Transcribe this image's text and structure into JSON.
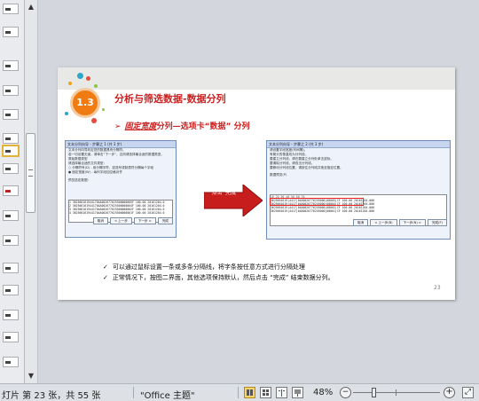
{
  "status": {
    "slide_info": "灯片 第 23 张，共 55 张",
    "theme": "\"Office 主题\"",
    "zoom": "48%",
    "zoom_out": "−",
    "zoom_in": "+"
  },
  "scrollbar": {
    "up": "▲",
    "down": "▼"
  },
  "slide": {
    "badge": "1.3",
    "title": "分析与筛选数据-数据分列",
    "subtitle_bullet": "➢",
    "subtitle_italic": "固定宽度",
    "subtitle_rest": "分列—选项卡“数据” 分列",
    "arrow_label": "点击“完成”",
    "bullets": [
      "可以通过鼠标设置一条或多条分隔线，将字条按任意方式进行分隔处理",
      "正常情况下，按图二界面，其他选项保持默认，然后点击 “完成” 结束数据分列。"
    ],
    "check": "✓",
    "page_number": "23"
  },
  "left_dialog": {
    "title": "文本分列向导 - 步骤之 1 (共 3 步)",
    "lines": [
      "文本分列向导判定您的数据具有分隔符。",
      "若一切设置无误，请单击“下一步”，否则请选择最合适的数据类型。",
      "原始数据类型",
      "请选择最合适的文件类型：",
      "○ 分隔符号(D) - 用分隔字符，如逗号或制表符分隔每个字段",
      "● 固定宽度(W) - 每列字段加空格对齐"
    ],
    "preview_label": "预览选定数据：",
    "rows": [
      "1 3625661619441704A002677625500000005F 100.00 20161204.0",
      "2 3625661619441704A002677625500000004F 100.00 20161204.0",
      "3 3625661619441704A002677625500000002F 100.00 20161204.0",
      "4 3625661619441704A002677625500000001F 100.00 20161204.0"
    ],
    "buttons": [
      "取消",
      "< 上一步",
      "下一步 >",
      "完成"
    ]
  },
  "right_dialog": {
    "title": "文本分列向导 - 步骤之 2 (共 3 步)",
    "lines": [
      "请设置字段宽度(列间隔)。",
      "有箭头的垂直线为分列线。",
      "要建立分列线，请在要建立分列处单击鼠标。",
      "要清除分列线，请双击分列线。",
      "要移动分列线位置，请按住分列线并拖至指定位置。"
    ],
    "preview_label": "数据预览(P)",
    "ruler": "10     20     30     40     50     60     70",
    "rows": [
      "3625661619|4417|04A0026776255000|00005|CF 100.00 20161204.000",
      "3625661619|4417|04A0026776255000|00004|CF 100.00 20161204.000",
      "3625661619|4417|04A0026776255000|00002|CF 100.00 20161204.000",
      "3625661619|4417|04A0026776255000|00001|CF 100.00 20161204.000"
    ],
    "buttons": [
      "取消",
      "< 上一步(B)",
      "下一步(N) >",
      "完成(F)"
    ]
  },
  "colors": {
    "accent_red": "#cc1f1f",
    "badge_orange": "#ef7b12",
    "arrow_red": "#c81d1d"
  }
}
